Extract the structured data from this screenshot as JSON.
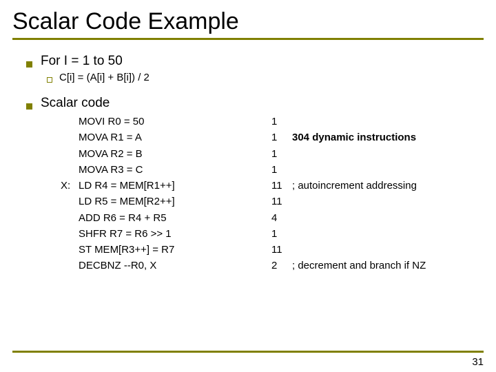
{
  "title": "Scalar Code Example",
  "bullet1": "For I = 1 to 50",
  "sub1": "C[i] = (A[i] + B[i]) / 2",
  "bullet2": "Scalar code",
  "code": [
    {
      "label": "",
      "instr": "MOVI R0 = 50",
      "cyc": "1",
      "cmt": ""
    },
    {
      "label": "",
      "instr": "MOVA R1 = A",
      "cyc": "1",
      "cmt": ""
    },
    {
      "label": "",
      "instr": "MOVA R2 = B",
      "cyc": "1",
      "cmt": ""
    },
    {
      "label": "",
      "instr": "MOVA R3 = C",
      "cyc": "1",
      "cmt": ""
    },
    {
      "label": "X:",
      "instr": "LD R4 = MEM[R1++]",
      "cyc": "11",
      "cmt": "; autoincrement addressing"
    },
    {
      "label": "",
      "instr": "LD R5 = MEM[R2++]",
      "cyc": "11",
      "cmt": ""
    },
    {
      "label": "",
      "instr": "ADD R6 = R4 + R5",
      "cyc": "4",
      "cmt": ""
    },
    {
      "label": "",
      "instr": "SHFR R7 = R6 >> 1",
      "cyc": "1",
      "cmt": ""
    },
    {
      "label": "",
      "instr": "ST MEM[R3++] = R7",
      "cyc": "11",
      "cmt": ""
    },
    {
      "label": "",
      "instr": "DECBNZ --R0, X",
      "cyc": "2",
      "cmt": "; decrement and branch if NZ"
    }
  ],
  "annotation": "304 dynamic instructions",
  "page": "31"
}
